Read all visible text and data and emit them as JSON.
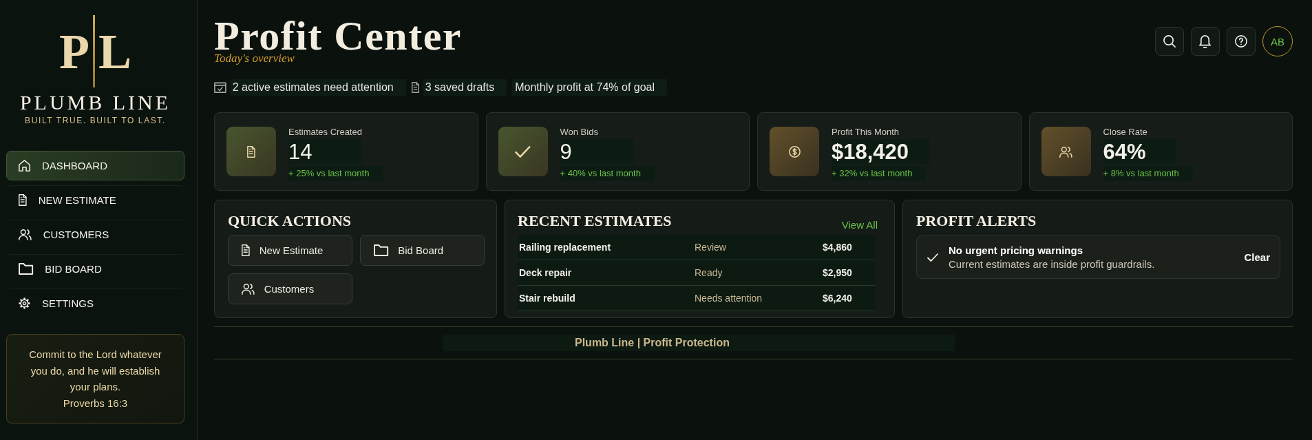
{
  "sidebar": {
    "logo": {
      "monogram": [
        "P",
        "L"
      ],
      "name": "PLUMB LINE",
      "tagline": "BUILT TRUE. BUILT TO LAST."
    },
    "nav": [
      {
        "label": "DASHBOARD",
        "selected": true
      },
      {
        "label": "NEW ESTIMATE",
        "selected": false
      },
      {
        "label": "CUSTOMERS",
        "selected": false
      },
      {
        "label": "BID BOARD",
        "selected": false
      },
      {
        "label": "SETTINGS",
        "selected": false
      }
    ],
    "quote": {
      "text": "Commit to the Lord whatever you do, and he will establish your plans.",
      "reference": "Proverbs 16:3"
    }
  },
  "header": {
    "title": "Profit Center",
    "subtitle": "Today's overview",
    "avatar": {
      "initials": "AB"
    },
    "notices": [
      {
        "kind": "attention",
        "text": "2 active estimates need attention"
      },
      {
        "kind": "drafts",
        "text": "3 saved drafts"
      },
      {
        "kind": "goal",
        "text": "Monthly profit at 74% of goal"
      }
    ]
  },
  "stats": [
    {
      "kind": "count",
      "label": "Estimates Created",
      "value": "14",
      "change": "+ 25% vs last month"
    },
    {
      "kind": "count",
      "label": "Won Bids",
      "value": "9",
      "change": "+ 40% vs last month"
    },
    {
      "kind": "amount",
      "label": "Profit This Month",
      "value": "$18,420",
      "change": "+ 32% vs last month"
    },
    {
      "kind": "amount",
      "label": "Close Rate",
      "value": "64%",
      "change": "+ 8% vs last month"
    }
  ],
  "quick_actions": {
    "title": "QUICK ACTIONS",
    "buttons": [
      "New Estimate",
      "Bid Board",
      "Customers"
    ]
  },
  "recent_estimates": {
    "title": "RECENT ESTIMATES",
    "link": "View All",
    "rows": [
      {
        "name": "Railing replacement",
        "status": "Review",
        "amount": "$4,860"
      },
      {
        "name": "Deck repair",
        "status": "Ready",
        "amount": "$2,950"
      },
      {
        "name": "Stair rebuild",
        "status": "Needs attention",
        "amount": "$6,240"
      }
    ]
  },
  "profit_alerts": {
    "title": "PROFIT ALERTS",
    "alerts": [
      {
        "title": "No urgent pricing warnings",
        "message": "Current estimates are inside profit guardrails.",
        "action": "Clear"
      }
    ]
  },
  "footer": {
    "text": "Plumb Line | Profit Protection"
  }
}
